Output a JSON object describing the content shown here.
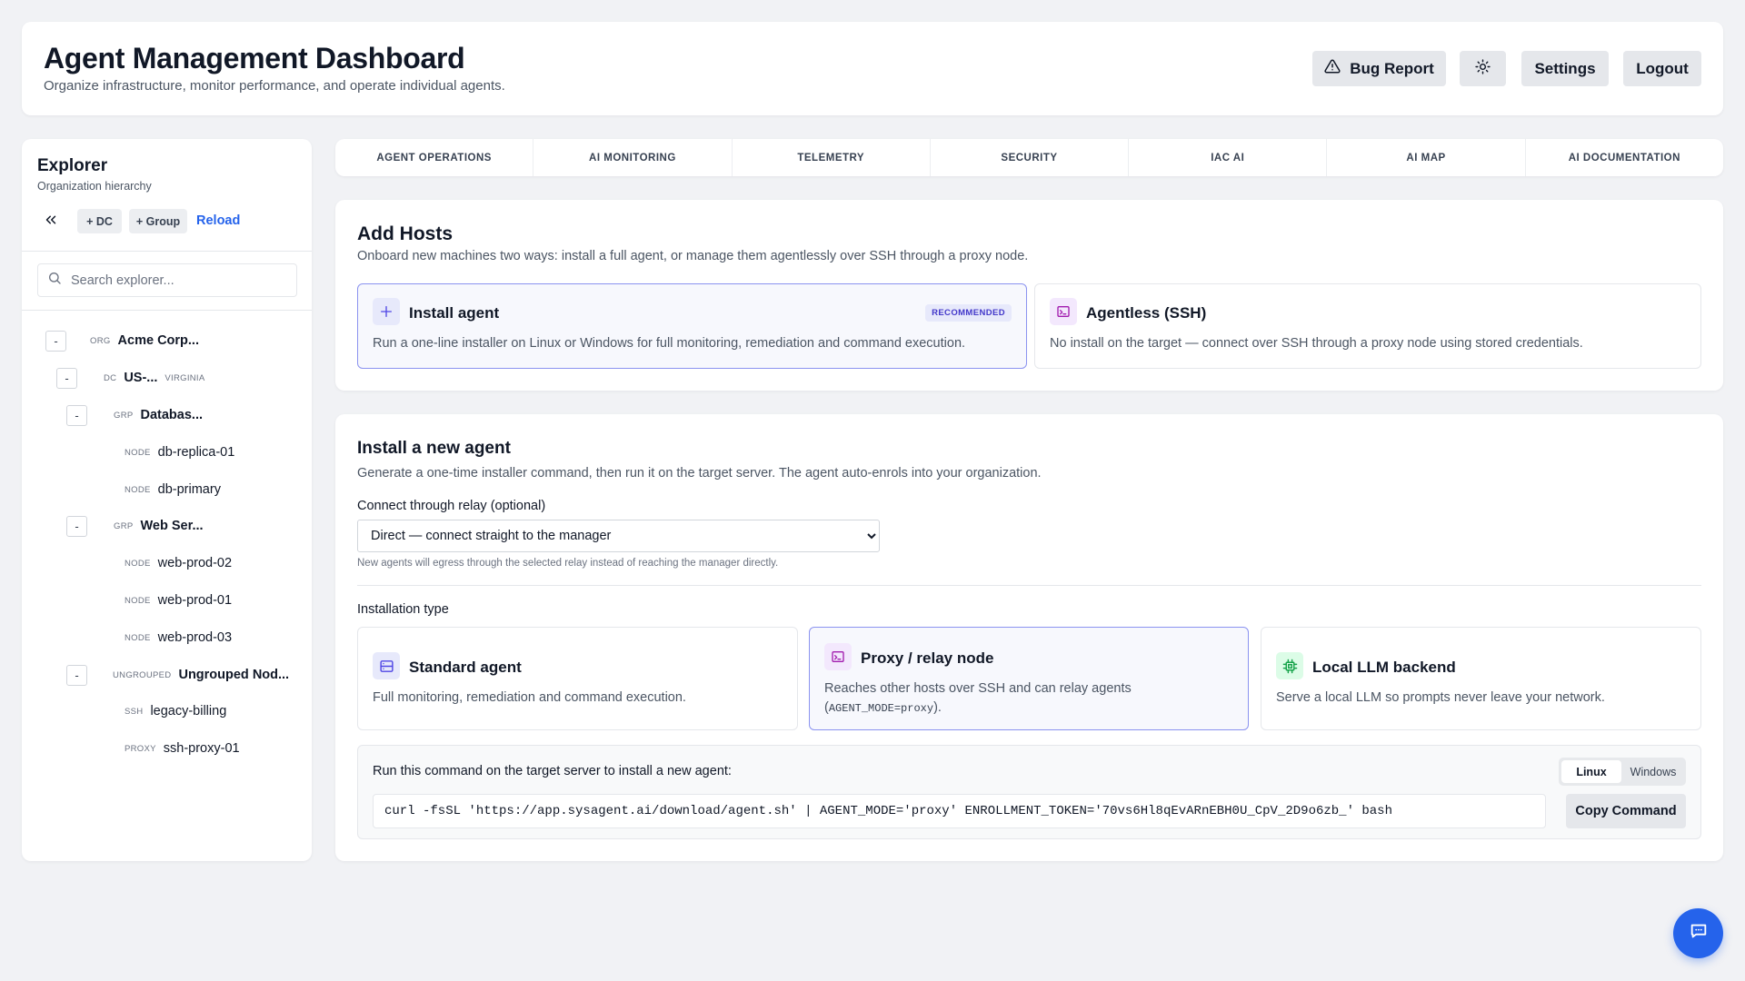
{
  "header": {
    "title": "Agent Management Dashboard",
    "subtitle": "Organize infrastructure, monitor performance, and operate individual agents.",
    "bug_report": "Bug Report",
    "settings": "Settings",
    "logout": "Logout",
    "theme_icon": "sun-icon"
  },
  "sidebar": {
    "title": "Explorer",
    "subtitle": "Organization hierarchy",
    "add_dc": "+ DC",
    "add_group": "+ Group",
    "reload": "Reload",
    "search_placeholder": "Search explorer...",
    "tree": [
      {
        "type": "ORG",
        "name": "Acme Corp...",
        "toggle": "-"
      },
      {
        "type": "DC",
        "name": "US-...",
        "sub": "VIRGINIA",
        "toggle": "-"
      },
      {
        "type": "GRP",
        "name": "Databas...",
        "toggle": "-"
      },
      {
        "type": "NODE",
        "name": "db-replica-01"
      },
      {
        "type": "NODE",
        "name": "db-primary"
      },
      {
        "type": "GRP",
        "name": "Web Ser...",
        "toggle": "-"
      },
      {
        "type": "NODE",
        "name": "web-prod-02"
      },
      {
        "type": "NODE",
        "name": "web-prod-01"
      },
      {
        "type": "NODE",
        "name": "web-prod-03"
      },
      {
        "type": "UNGROUPED",
        "name": "Ungrouped Nod...",
        "toggle": "-"
      },
      {
        "type": "SSH",
        "name": "legacy-billing"
      },
      {
        "type": "PROXY",
        "name": "ssh-proxy-01"
      }
    ]
  },
  "tabs": [
    "AGENT OPERATIONS",
    "AI MONITORING",
    "TELEMETRY",
    "SECURITY",
    "IAC AI",
    "AI MAP",
    "AI DOCUMENTATION"
  ],
  "add_hosts": {
    "title": "Add Hosts",
    "description": "Onboard new machines two ways: install a full agent, or manage them agentlessly over SSH through a proxy node.",
    "options": [
      {
        "title": "Install agent",
        "badge": "RECOMMENDED",
        "description": "Run a one-line installer on Linux or Windows for full monitoring, remediation and command execution.",
        "icon": "plus-icon",
        "selected": true
      },
      {
        "title": "Agentless (SSH)",
        "description": "No install on the target — connect over SSH through a proxy node using stored credentials.",
        "icon": "terminal-icon",
        "selected": false
      }
    ]
  },
  "install": {
    "title": "Install a new agent",
    "description": "Generate a one-time installer command, then run it on the target server. The agent auto-enrols into your organization.",
    "relay_label": "Connect through relay (optional)",
    "relay_value": "Direct — connect straight to the manager",
    "relay_hint": "New agents will egress through the selected relay instead of reaching the manager directly.",
    "type_label": "Installation type",
    "types": [
      {
        "title": "Standard agent",
        "description": "Full monitoring, remediation and command execution.",
        "icon": "server-icon",
        "selected": false
      },
      {
        "title": "Proxy / relay node",
        "description": "Reaches other hosts over SSH and can relay agents",
        "code": "AGENT_MODE=proxy",
        "code_open": "(",
        "code_close": ").",
        "icon": "terminal-icon",
        "selected": true
      },
      {
        "title": "Local LLM backend",
        "description": "Serve a local LLM so prompts never leave your network.",
        "icon": "chip-icon",
        "selected": false
      }
    ],
    "command_label": "Run this command on the target server to install a new agent:",
    "os": [
      "Linux",
      "Windows"
    ],
    "os_active": "Linux",
    "command": "curl -fsSL 'https://app.sysagent.ai/download/agent.sh' | AGENT_MODE='proxy' ENROLLMENT_TOKEN='70vs6Hl8qEvARnEBH0U_CpV_2D9o6zb_' bash",
    "copy": "Copy Command"
  },
  "chat_icon": "chat-icon",
  "colors": {
    "accent": "#2563eb",
    "selected_border": "#8b93f0",
    "badge_bg": "#e7e9fb",
    "badge_text": "#4338ca"
  }
}
